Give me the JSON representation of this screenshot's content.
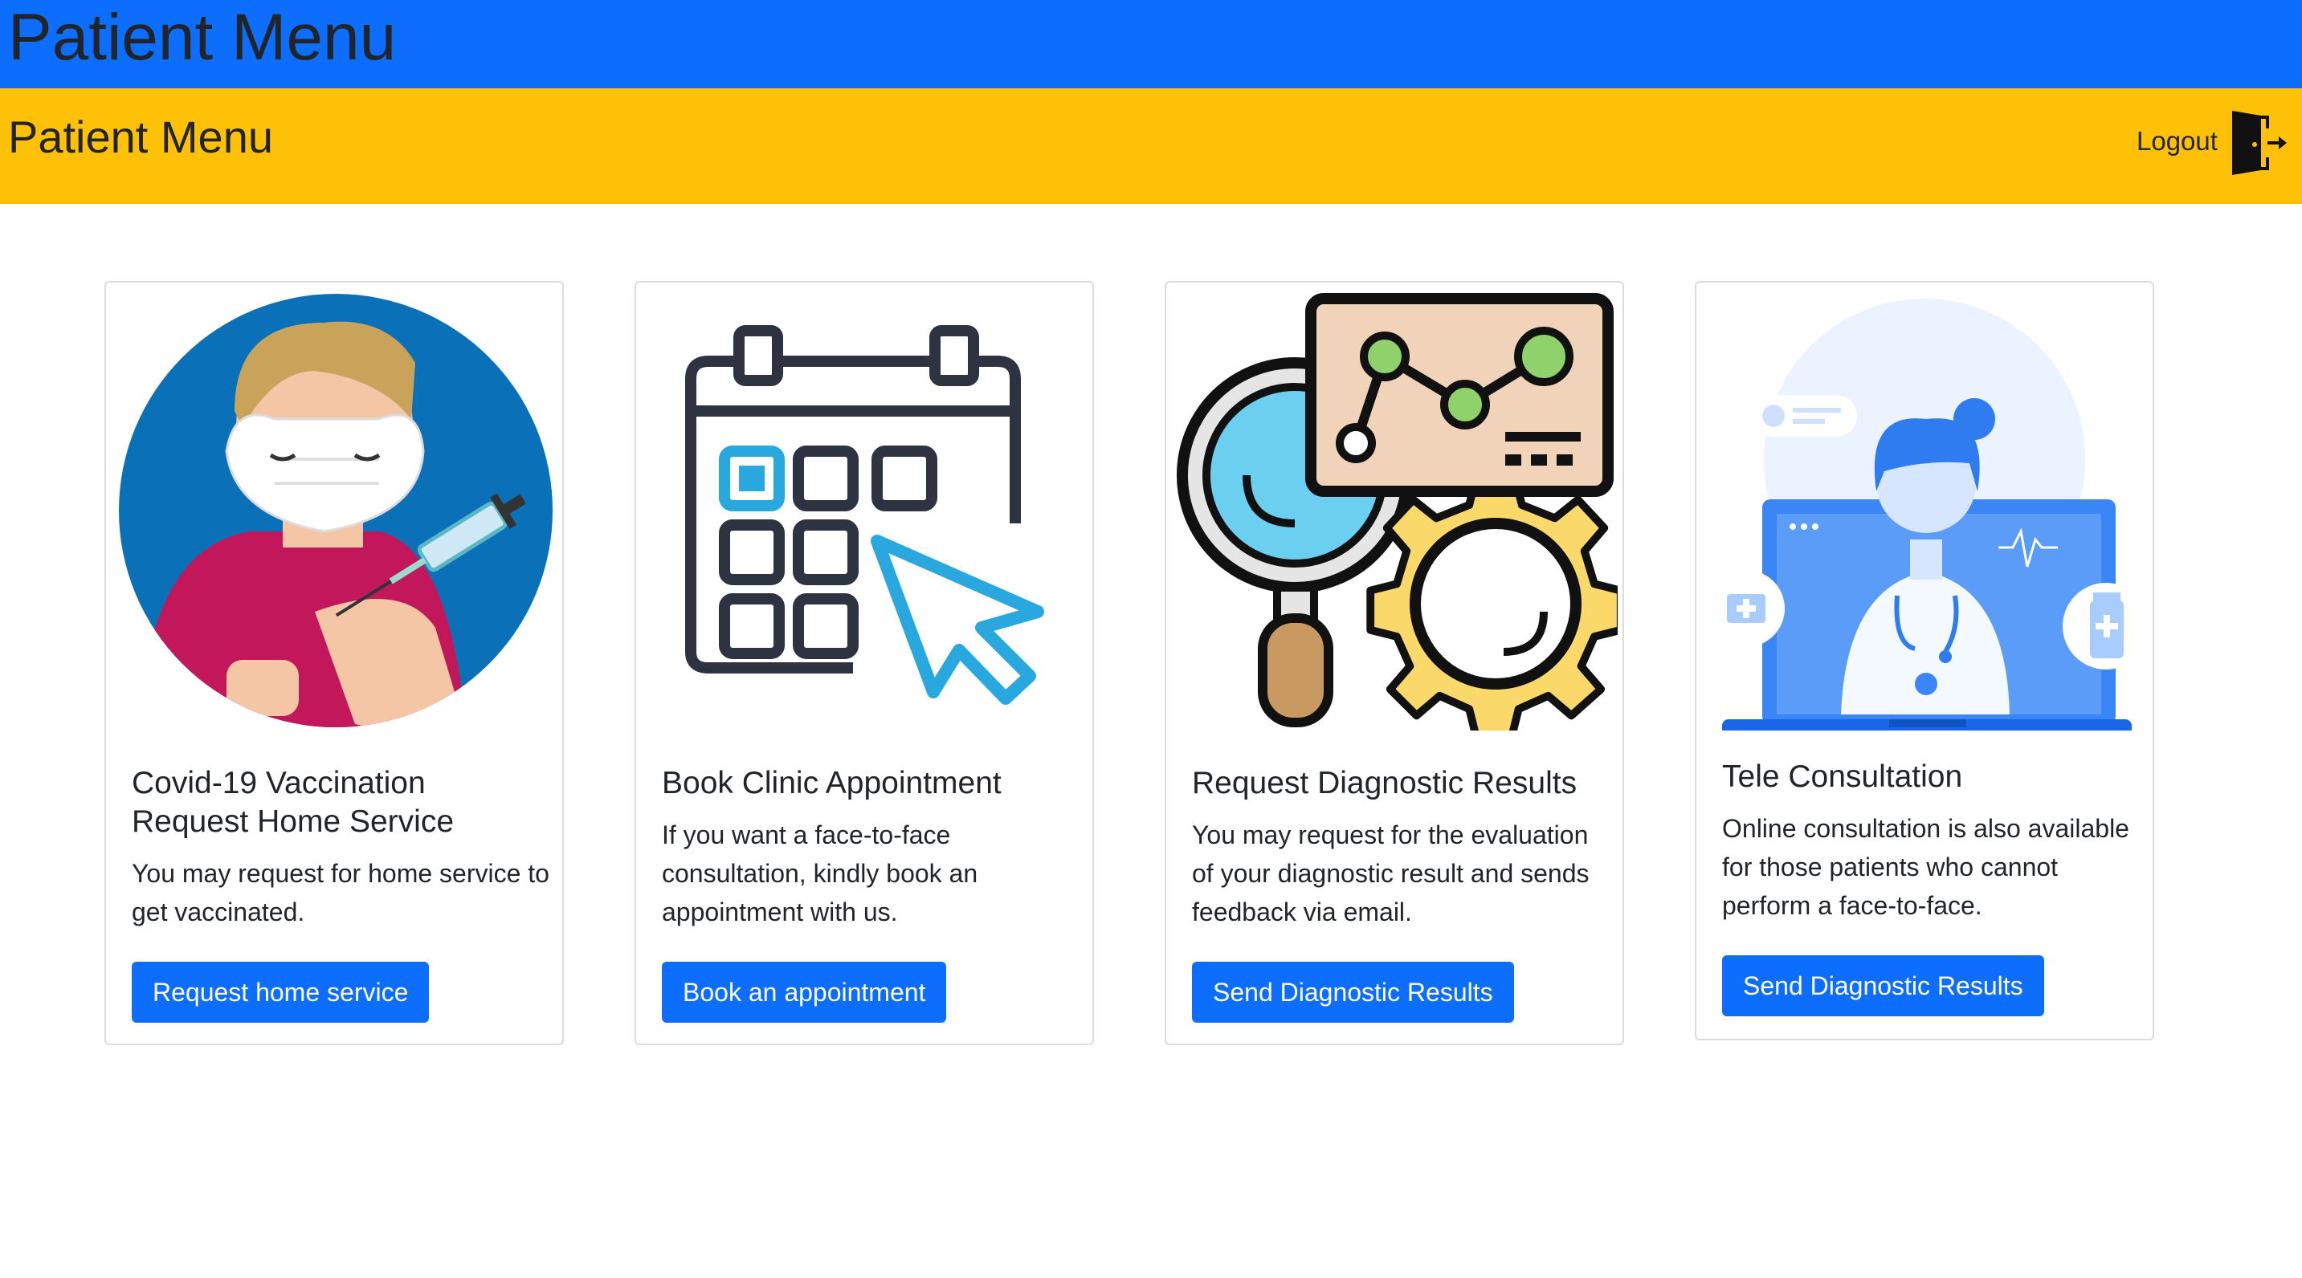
{
  "header": {
    "app_title": "Patient Menu",
    "page_title": "Patient Menu",
    "logout_label": "Logout"
  },
  "cards": [
    {
      "title": "Covid-19 Vaccination Request Home Service",
      "text": "You may request for home service to get vaccinated.",
      "button": "Request home service",
      "icon": "vaccination-illustration"
    },
    {
      "title": "Book Clinic Appointment",
      "text": "If you want a face-to-face consultation, kindly book an appointment with us.",
      "button": "Book an appointment",
      "icon": "calendar-cursor-illustration"
    },
    {
      "title": "Request Diagnostic Results",
      "text": "You may request for the evaluation of your diagnostic result and sends feedback via email.",
      "button": "Send Diagnostic Results",
      "icon": "diagnostic-analytics-illustration"
    },
    {
      "title": "Tele Consultation",
      "text": "Online consultation is also available for those patients who cannot perform a face-to-face.",
      "button": "Send Diagnostic Results",
      "icon": "doctor-laptop-illustration"
    }
  ],
  "colors": {
    "primary": "#0d6efd",
    "warning": "#ffc107",
    "text": "#212529"
  }
}
